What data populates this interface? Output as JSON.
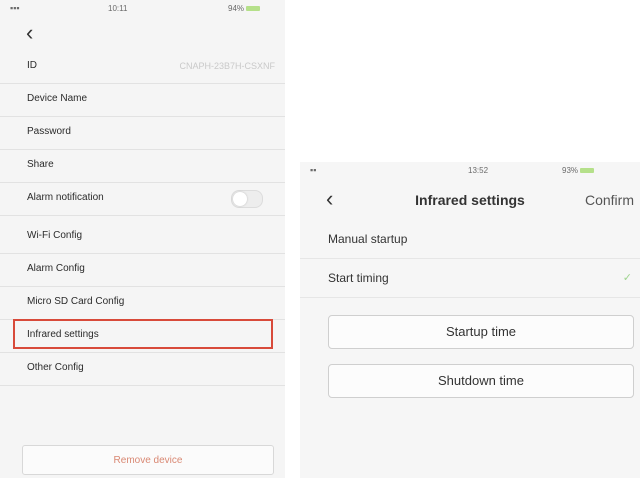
{
  "left_screen": {
    "status": {
      "time": "10:11",
      "battery": "94%"
    },
    "rows": [
      {
        "label": "ID",
        "value": "CNAPH-23B7H-CSXNF"
      },
      {
        "label": "Device Name"
      },
      {
        "label": "Password"
      },
      {
        "label": "Share"
      },
      {
        "label": "Alarm notification"
      },
      {
        "label": "Wi-Fi Config"
      },
      {
        "label": "Alarm Config"
      },
      {
        "label": "Micro SD Card Config"
      },
      {
        "label": "Infrared settings"
      },
      {
        "label": "Other Config"
      }
    ],
    "remove_button": "Remove device",
    "highlight_color": "#d84a3a"
  },
  "right_screen": {
    "status": {
      "time": "13:52",
      "battery": "93%"
    },
    "title": "Infrared settings",
    "confirm": "Confirm",
    "options": [
      {
        "label": "Manual startup",
        "selected": false
      },
      {
        "label": "Start timing",
        "selected": true
      }
    ],
    "buttons": {
      "startup": "Startup time",
      "shutdown": "Shutdown time"
    }
  }
}
